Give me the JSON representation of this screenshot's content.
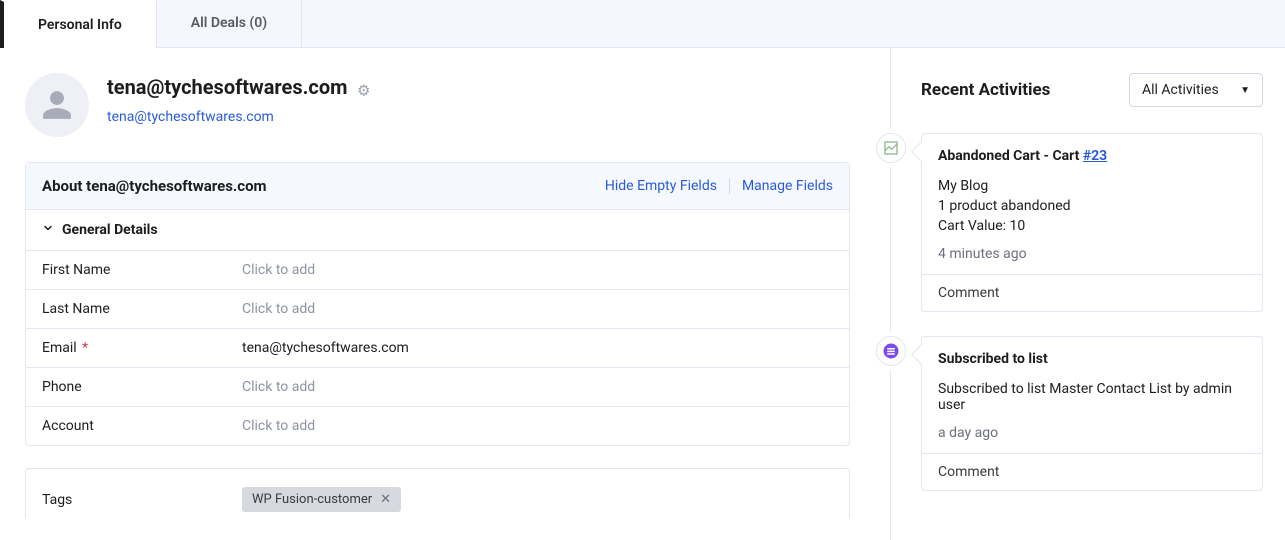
{
  "tabs": {
    "personal_info": "Personal Info",
    "all_deals": "All Deals (0)"
  },
  "header": {
    "display_name": "tena@tychesoftwares.com",
    "email": "tena@tychesoftwares.com"
  },
  "about": {
    "panel_title": "About tena@tychesoftwares.com",
    "hide_empty": "Hide Empty Fields",
    "manage_fields": "Manage Fields",
    "section_title": "General Details",
    "placeholder": "Click to add",
    "fields": {
      "first_name_label": "First Name",
      "last_name_label": "Last Name",
      "email_label": "Email",
      "phone_label": "Phone",
      "account_label": "Account",
      "email_value": "tena@tychesoftwares.com"
    }
  },
  "tags": {
    "label": "Tags",
    "chip": "WP Fusion-customer"
  },
  "activities": {
    "title": "Recent Activities",
    "filter": "All Activities",
    "comment_label": "Comment",
    "items": [
      {
        "title_prefix": "Abandoned Cart - Cart ",
        "title_link": "#23",
        "line1": "My Blog",
        "line2": "1 product abandoned",
        "line3_label": "Cart Value: ",
        "line3_value": "10",
        "time": "4 minutes ago"
      },
      {
        "title": "Subscribed to list",
        "desc": "Subscribed to list Master Contact List by admin user",
        "time": "a day ago"
      }
    ]
  }
}
